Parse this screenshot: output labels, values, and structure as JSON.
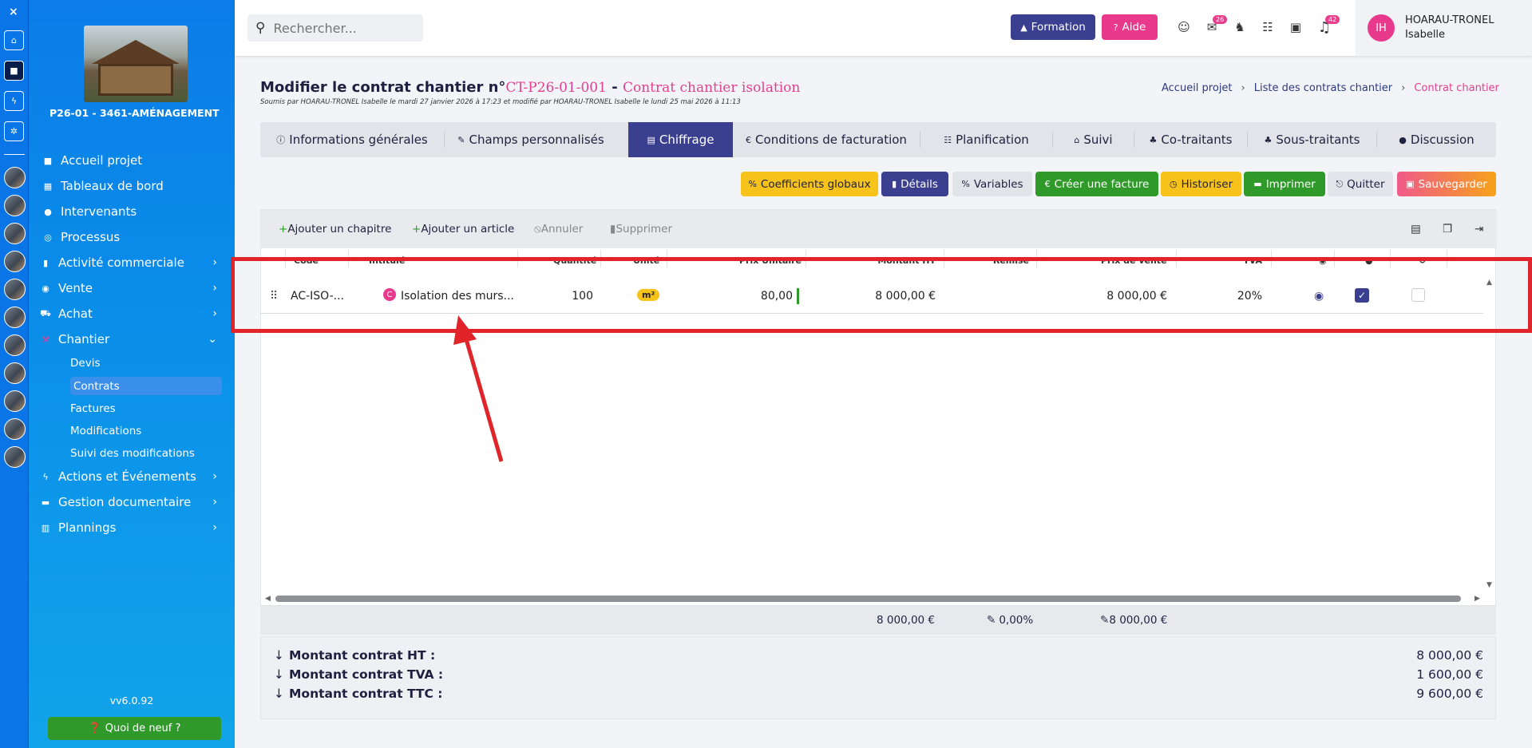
{
  "rail": {
    "close": "×"
  },
  "sidebar": {
    "project_name": "P26-01 - 3461-AMÉNAGEMENT",
    "items": [
      {
        "label": "Accueil projet"
      },
      {
        "label": "Tableaux de bord"
      },
      {
        "label": "Intervenants"
      },
      {
        "label": "Processus"
      },
      {
        "label": "Activité commerciale"
      },
      {
        "label": "Vente"
      },
      {
        "label": "Achat"
      },
      {
        "label": "Chantier"
      },
      {
        "label": "Actions et Événements"
      },
      {
        "label": "Gestion documentaire"
      },
      {
        "label": "Plannings"
      }
    ],
    "chantier_sub": [
      "Devis",
      "Contrats",
      "Factures",
      "Modifications",
      "Suivi des modifications"
    ],
    "version": "vv6.0.92",
    "whats_new": "Quoi de neuf ?"
  },
  "topbar": {
    "search_placeholder": "Rechercher...",
    "formation": "Formation",
    "aide": "Aide",
    "mail_badge": "26",
    "notif_badge": "42",
    "user_initials": "IH",
    "user_name": "HOARAU-TRONEL",
    "user_first": "Isabelle"
  },
  "header": {
    "title_prefix": "Modifier le contrat chantier n°",
    "ref": "CT-P26-01-001",
    "sep": " - ",
    "contract_name": "Contrat chantier isolation",
    "subtitle": "Soumis par HOARAU-TRONEL Isabelle le mardi 27 janvier 2026 à 17:23 et modifié par HOARAU-TRONEL Isabelle le lundi 25 mai 2026 à 11:13",
    "breadcrumb": [
      "Accueil projet",
      "Liste des contrats chantier",
      "Contrat chantier"
    ]
  },
  "tabs": [
    "Informations générales",
    "Champs personnalisés",
    "Chiffrage",
    "Conditions de facturation",
    "Planification",
    "Suivi",
    "Co-traitants",
    "Sous-traitants",
    "Discussion"
  ],
  "actions": [
    "Coefficients globaux",
    "Détails",
    "Variables",
    "Créer une facture",
    "Historiser",
    "Imprimer",
    "Quitter",
    "Sauvegarder"
  ],
  "toolbar": [
    "Ajouter un chapitre",
    "Ajouter un article",
    "Annuler",
    "Supprimer"
  ],
  "columns": [
    "Code",
    "Intitulé",
    "Quantité",
    "Unité",
    "Prix Unitaire",
    "Montant HT",
    "Remise",
    "Prix de vente",
    "TVA"
  ],
  "row": {
    "code": "AC-ISO-...",
    "type_badge": "C",
    "label": "Isolation des murs...",
    "quantity": "100",
    "unit": "m²",
    "unit_price": "80,00",
    "amount_ht": "8 000,00 €",
    "sale_price": "8 000,00 €",
    "tva": "20%"
  },
  "footer": {
    "total_ht": "8 000,00 €",
    "discount": "0,00%",
    "sale": "8 000,00 €"
  },
  "summary": [
    {
      "label": "Montant contrat HT :",
      "value": "8 000,00 €"
    },
    {
      "label": "Montant contrat TVA :",
      "value": "1 600,00 €"
    },
    {
      "label": "Montant contrat TTC :",
      "value": "9 600,00 €"
    }
  ],
  "colors": {
    "accent": "#3b3f8f",
    "pink": "#e0408f",
    "annotation": "#e0242a"
  }
}
